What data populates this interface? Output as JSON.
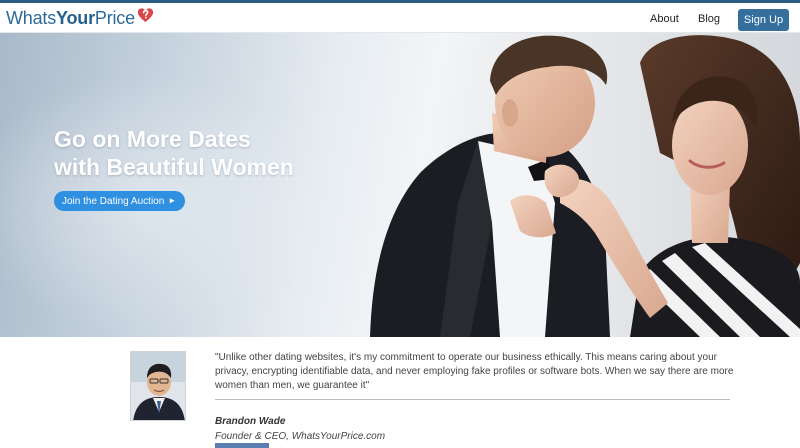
{
  "brand": {
    "name_part1": "Whats",
    "name_part2": "Your",
    "name_part3": "Price",
    "accent_red": "#d9474b",
    "accent_blue": "#2d6a9a"
  },
  "nav": {
    "about_label": "About",
    "blog_label": "Blog",
    "signup_label": "Sign Up"
  },
  "hero": {
    "title_line1": "Go on More Dates",
    "title_line2": "with Beautiful Women",
    "cta_label": "Join the Dating Auction",
    "cta_arrow": "►"
  },
  "testimonial": {
    "quote": "\"Unlike other dating websites, it's my commitment to operate our business ethically. This means caring about your privacy, encrypting identifiable data, and never employing fake profiles or software bots. When we say there are more women than men, we guarantee it\"",
    "author_name": "Brandon Wade",
    "author_title": "Founder & CEO, WhatsYourPrice.com"
  },
  "icons": {
    "logo_mark": "heart-question-icon",
    "cta_arrow": "play-arrow-icon"
  }
}
